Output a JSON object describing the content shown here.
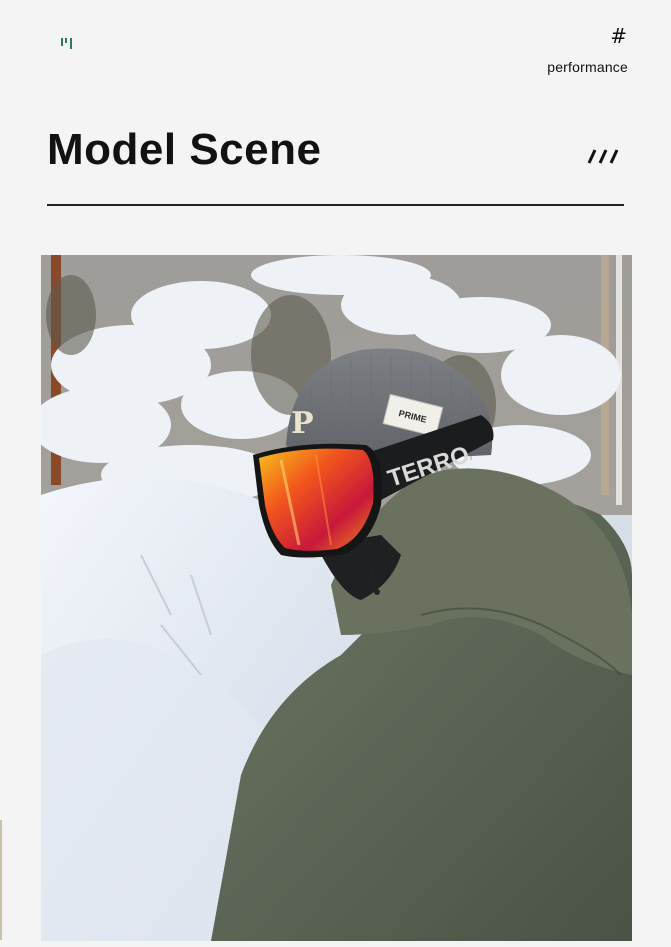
{
  "header": {
    "hash_symbol": "#",
    "tagline": "performance",
    "logo_icon": "brand-mark-icon",
    "accent_color": "#2f7a5b"
  },
  "section": {
    "title": "Model Scene",
    "decoration_icon": "triple-slash-icon"
  },
  "photo": {
    "beanie_tag_text": "PRIME",
    "goggle_strap_text": "TERRO",
    "beanie_letter": "P"
  }
}
